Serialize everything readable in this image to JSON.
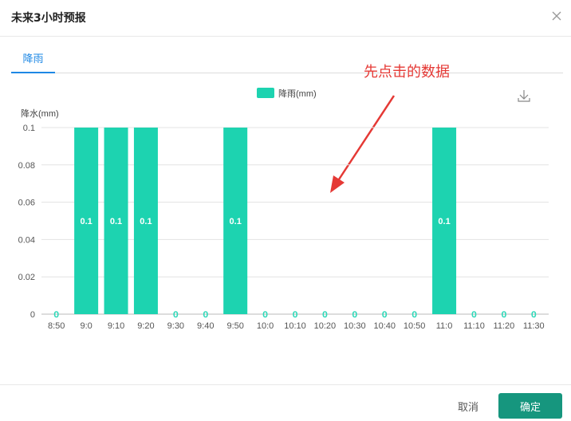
{
  "dialog": {
    "title": "未来3小时预报",
    "close_icon": "close-icon"
  },
  "tabs": [
    {
      "label": "降雨",
      "active": true
    }
  ],
  "annotation": "先点击的数据",
  "footer": {
    "cancel_label": "取消",
    "ok_label": "确定"
  },
  "colors": {
    "accent": "#1e88e5",
    "bar": "#1dd3b0",
    "primary_button": "#16967e",
    "annotation": "#e53935"
  },
  "chart_data": {
    "type": "bar",
    "ylabel": "降水(mm)",
    "legend": {
      "label": "降雨(mm)",
      "placement": "top-center"
    },
    "ylim": [
      0,
      0.1
    ],
    "yticks": [
      0,
      0.02,
      0.04,
      0.06,
      0.08,
      0.1
    ],
    "grid": true,
    "categories": [
      "8:50",
      "9:0",
      "9:10",
      "9:20",
      "9:30",
      "9:40",
      "9:50",
      "10:0",
      "10:10",
      "10:20",
      "10:30",
      "10:40",
      "10:50",
      "11:0",
      "11:10",
      "11:20",
      "11:30"
    ],
    "values": [
      0,
      0.1,
      0.1,
      0.1,
      0,
      0,
      0.1,
      0,
      0,
      0,
      0,
      0,
      0,
      0.1,
      0,
      0,
      0
    ],
    "data_labels": [
      "0",
      "0.1",
      "0.1",
      "0.1",
      "0",
      "0",
      "0.1",
      "0",
      "0",
      "0",
      "0",
      "0",
      "0",
      "0.1",
      "0",
      "0",
      "0"
    ],
    "download_icon": "download-icon"
  }
}
